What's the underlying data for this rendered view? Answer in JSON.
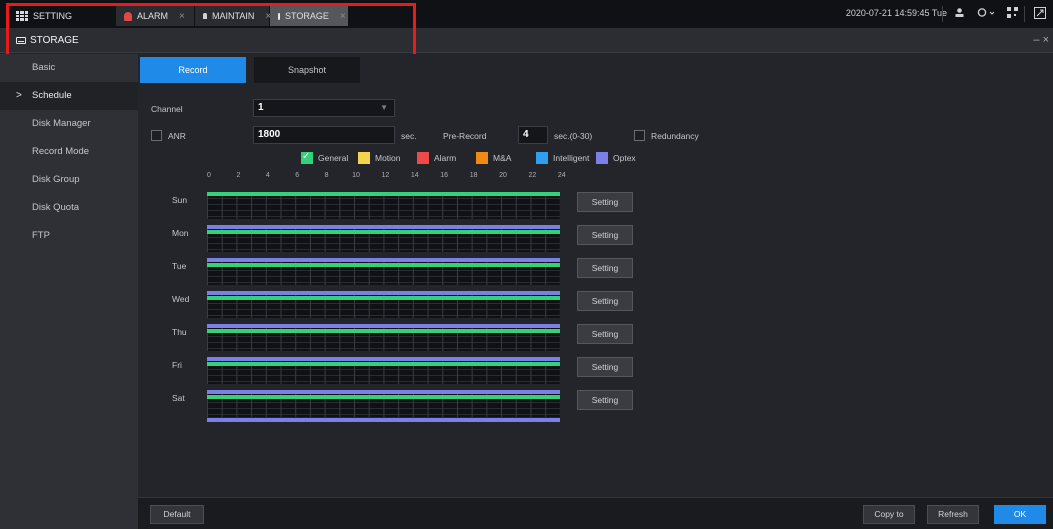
{
  "tabs": [
    {
      "label": "SETTING"
    },
    {
      "label": "ALARM"
    },
    {
      "label": "MAINTAIN"
    },
    {
      "label": "STORAGE"
    }
  ],
  "tab_close": "×",
  "datetime": "2020-07-21 14:59:45 Tue",
  "page_title": "STORAGE",
  "window_control": "– ×",
  "sidebar": {
    "items": [
      {
        "label": "Basic"
      },
      {
        "label": "Schedule"
      },
      {
        "label": "Disk Manager"
      },
      {
        "label": "Record Mode"
      },
      {
        "label": "Disk Group"
      },
      {
        "label": "Disk Quota"
      },
      {
        "label": "FTP"
      }
    ],
    "active_marker": ">"
  },
  "subtabs": {
    "record": "Record",
    "snapshot": "Snapshot"
  },
  "form": {
    "channel_label": "Channel",
    "channel_value": "1",
    "anr_label": "ANR",
    "anr_value": "1800",
    "anr_unit": "sec.",
    "prerecord_label": "Pre-Record",
    "prerecord_value": "4",
    "prerecord_unit": "sec.(0-30)",
    "redundancy_label": "Redundancy"
  },
  "legend": [
    {
      "label": "General",
      "color": "#35d07a",
      "checked": true
    },
    {
      "label": "Motion",
      "color": "#f2d54a"
    },
    {
      "label": "Alarm",
      "color": "#ef4a4a"
    },
    {
      "label": "M&A",
      "color": "#f08a12"
    },
    {
      "label": "Intelligent",
      "color": "#2fa0f0"
    },
    {
      "label": "Optex",
      "color": "#7b7fe8"
    }
  ],
  "hours": [
    "0",
    "2",
    "4",
    "6",
    "8",
    "10",
    "12",
    "14",
    "16",
    "18",
    "20",
    "22",
    "24"
  ],
  "days": [
    "Sun",
    "Mon",
    "Tue",
    "Wed",
    "Thu",
    "Fri",
    "Sat"
  ],
  "setting_label": "Setting",
  "footer": {
    "default": "Default",
    "copy_to": "Copy to",
    "refresh": "Refresh",
    "ok": "OK"
  }
}
